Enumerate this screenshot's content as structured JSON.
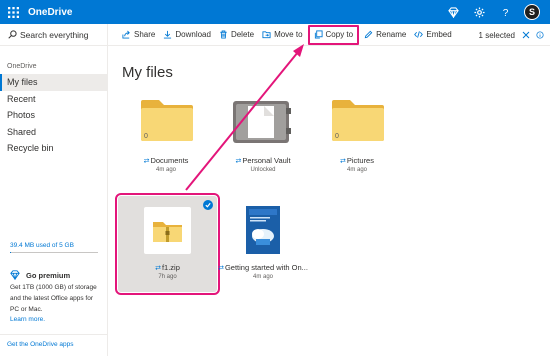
{
  "app": {
    "title": "OneDrive",
    "user_initial": "S"
  },
  "topbar": {
    "icons": [
      "waffle-icon",
      "diamond-icon",
      "gear-icon",
      "help-icon"
    ]
  },
  "sidebar": {
    "search_placeholder": "Search everything",
    "section": "OneDrive",
    "items": [
      {
        "label": "My files",
        "active": true
      },
      {
        "label": "Recent"
      },
      {
        "label": "Photos"
      },
      {
        "label": "Shared"
      },
      {
        "label": "Recycle bin"
      }
    ],
    "storage": "39.4 MB used of 5 GB",
    "storage_used_fraction": 0.008,
    "premium_title": "Go premium",
    "premium_desc": "Get 1TB (1000 GB) of storage and the latest Office apps for PC or Mac.",
    "learn_more": "Learn more.",
    "get_apps": "Get the OneDrive apps"
  },
  "commands": {
    "share": "Share",
    "download": "Download",
    "delete": "Delete",
    "move_to": "Move to",
    "copy_to": "Copy to",
    "rename": "Rename",
    "embed": "Embed",
    "selected": "1 selected"
  },
  "main": {
    "title": "My files",
    "items": [
      {
        "name": "Documents",
        "sub": "4m ago",
        "count": "0",
        "type": "folder"
      },
      {
        "name": "Personal Vault",
        "sub": "Unlocked",
        "type": "vault"
      },
      {
        "name": "Pictures",
        "sub": "4m ago",
        "count": "0",
        "type": "folder"
      },
      {
        "name": "f1.zip",
        "sub": "7h ago",
        "type": "zip",
        "selected": true
      },
      {
        "name": "Getting started with On...",
        "sub": "4m ago",
        "type": "pdf"
      }
    ]
  },
  "colors": {
    "accent": "#0078d4",
    "highlight": "#e3157a",
    "folder": "#f8d775"
  }
}
